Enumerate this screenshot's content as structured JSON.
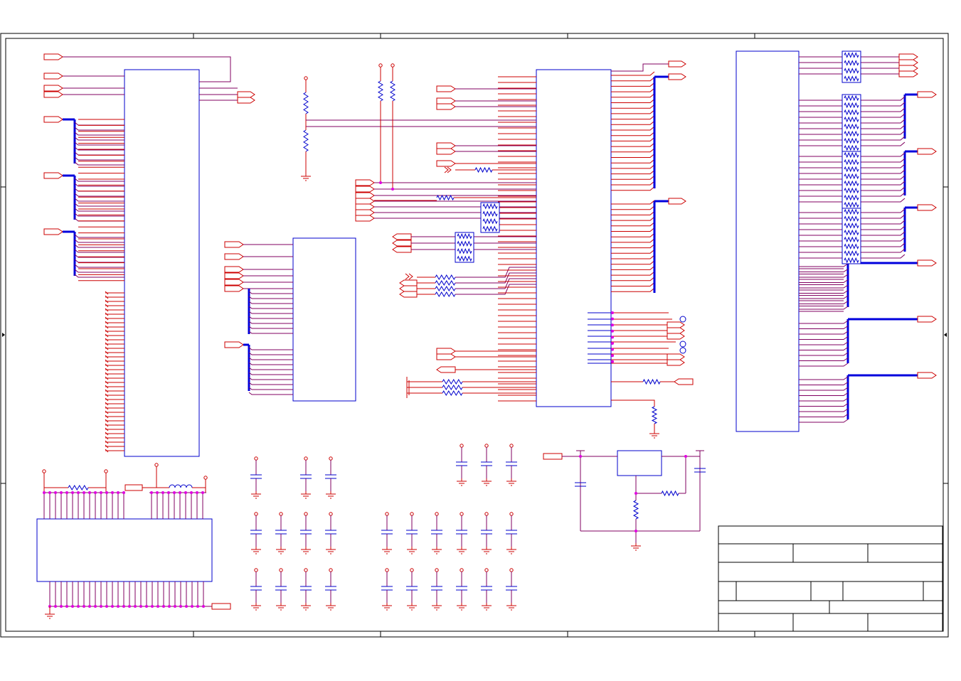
{
  "sheet": {
    "colors": {
      "wire": "#cc0000",
      "wire_alt": "#800060",
      "bus": "#0000dd",
      "component": "#0000cc",
      "junction": "#e000e0",
      "frame": "#000000"
    },
    "icons": [
      "off-page-port-icon",
      "resistor-icon",
      "capacitor-icon",
      "inductor-icon",
      "ground-icon",
      "power-pin-icon",
      "junction-dot-icon",
      "test-point-icon"
    ]
  },
  "title_block": {
    "text": []
  }
}
